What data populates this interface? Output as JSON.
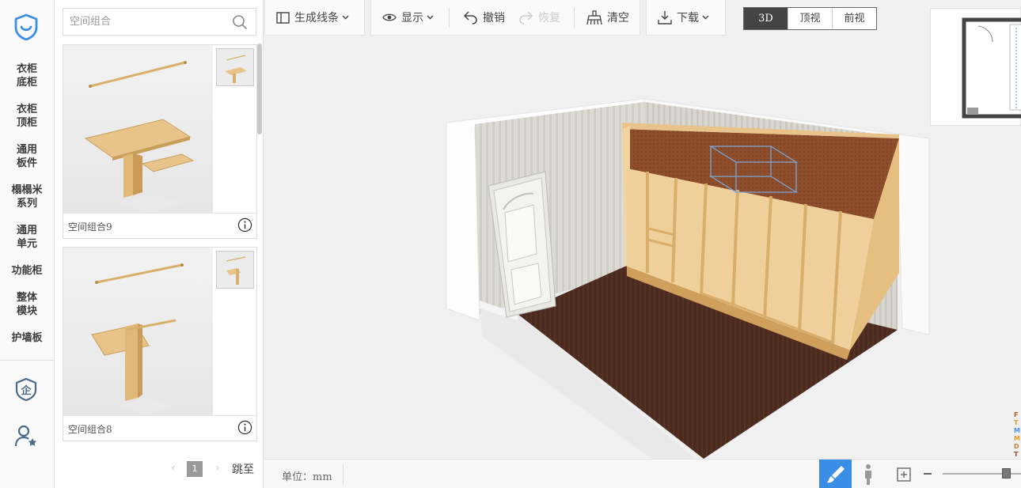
{
  "nav": {
    "categories": [
      {
        "line1": "衣柜",
        "line2": "底柜"
      },
      {
        "line1": "衣柜",
        "line2": "顶柜"
      },
      {
        "line1": "通用",
        "line2": "板件"
      },
      {
        "line1": "榻榻米",
        "line2": "系列"
      },
      {
        "line1": "通用",
        "line2": "单元"
      },
      {
        "line1": "功能柜",
        "line2": ""
      },
      {
        "line1": "整体",
        "line2": "模块"
      },
      {
        "line1": "护墙板",
        "line2": ""
      }
    ]
  },
  "library": {
    "search_placeholder": "空间组合",
    "items": [
      {
        "title": "空间组合9"
      },
      {
        "title": "空间组合8"
      }
    ],
    "pager": {
      "current_page": "1",
      "jump_label": "跳至"
    }
  },
  "toolbar": {
    "generate_lines": "生成线条",
    "display": "显示",
    "undo": "撤销",
    "redo": "恢复",
    "clear": "清空",
    "download": "下载",
    "views": [
      "3D",
      "顶视",
      "前视"
    ],
    "active_view": "3D"
  },
  "status": {
    "unit_label": "单位：mm"
  },
  "colors": {
    "accent": "#3a8ee6",
    "wood_light": "#e8c48a",
    "wood_dark": "#8b4a2b",
    "floor": "#4a2a1e"
  }
}
